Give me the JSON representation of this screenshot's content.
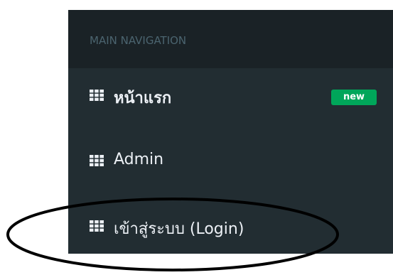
{
  "sidebar": {
    "header": "MAIN NAVIGATION",
    "items": [
      {
        "label": "หน้าแรก",
        "icon": "grid-icon",
        "badge": "new"
      },
      {
        "label": "Admin",
        "icon": "grid-icon"
      },
      {
        "label": "เข้าสู่ระบบ (Login)",
        "icon": "grid-icon"
      }
    ]
  },
  "colors": {
    "sidebar_bg": "#222d32",
    "header_bg": "#1a2226",
    "header_text": "#4b646f",
    "item_text": "#ecf0f5",
    "badge_bg": "#00a65a",
    "annotation": "#000000"
  }
}
